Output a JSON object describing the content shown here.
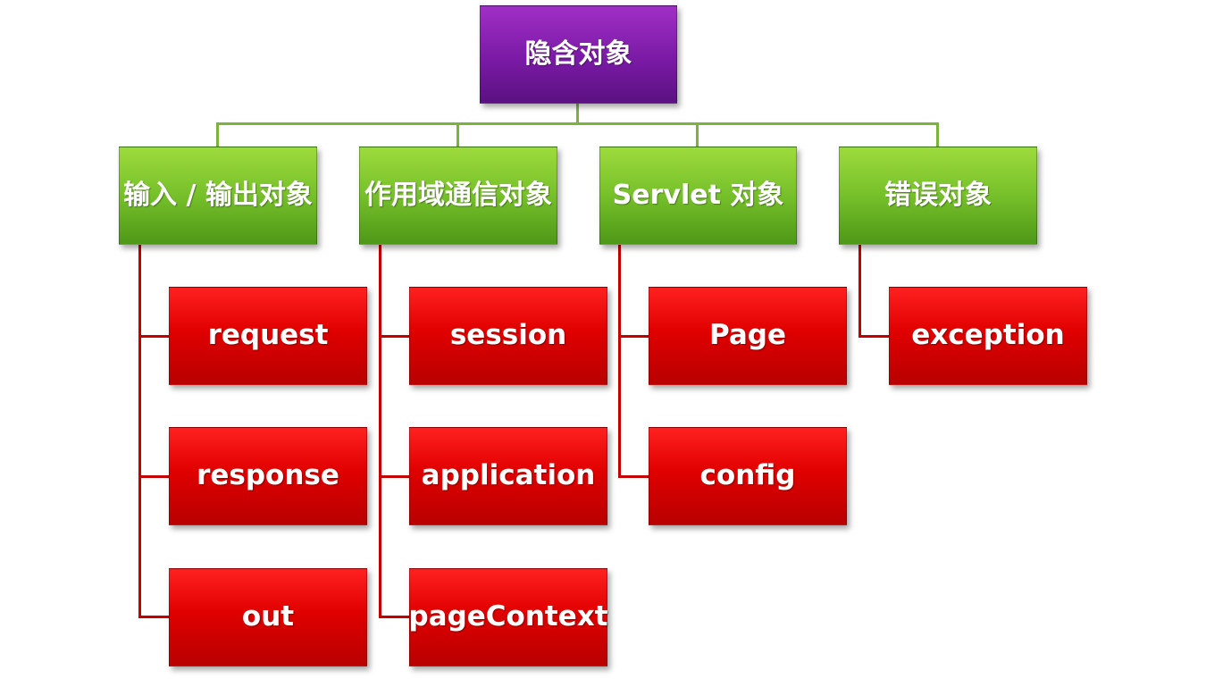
{
  "root": {
    "label": "隐含对象"
  },
  "categories": [
    {
      "label": "输入 / 输出对象",
      "children": [
        "request",
        "response",
        "out"
      ]
    },
    {
      "label": "作用域通信对象",
      "children": [
        "session",
        "application",
        "pageContext"
      ]
    },
    {
      "label": "Servlet 对象",
      "children": [
        "Page",
        "config"
      ]
    },
    {
      "label": "错误对象",
      "children": [
        "exception"
      ]
    }
  ],
  "colors": {
    "root": "#7a1aa5",
    "category": "#76c02a",
    "leaf": "#e00000",
    "connector_green": "#7ab43a",
    "connector_red": "#c40000"
  }
}
